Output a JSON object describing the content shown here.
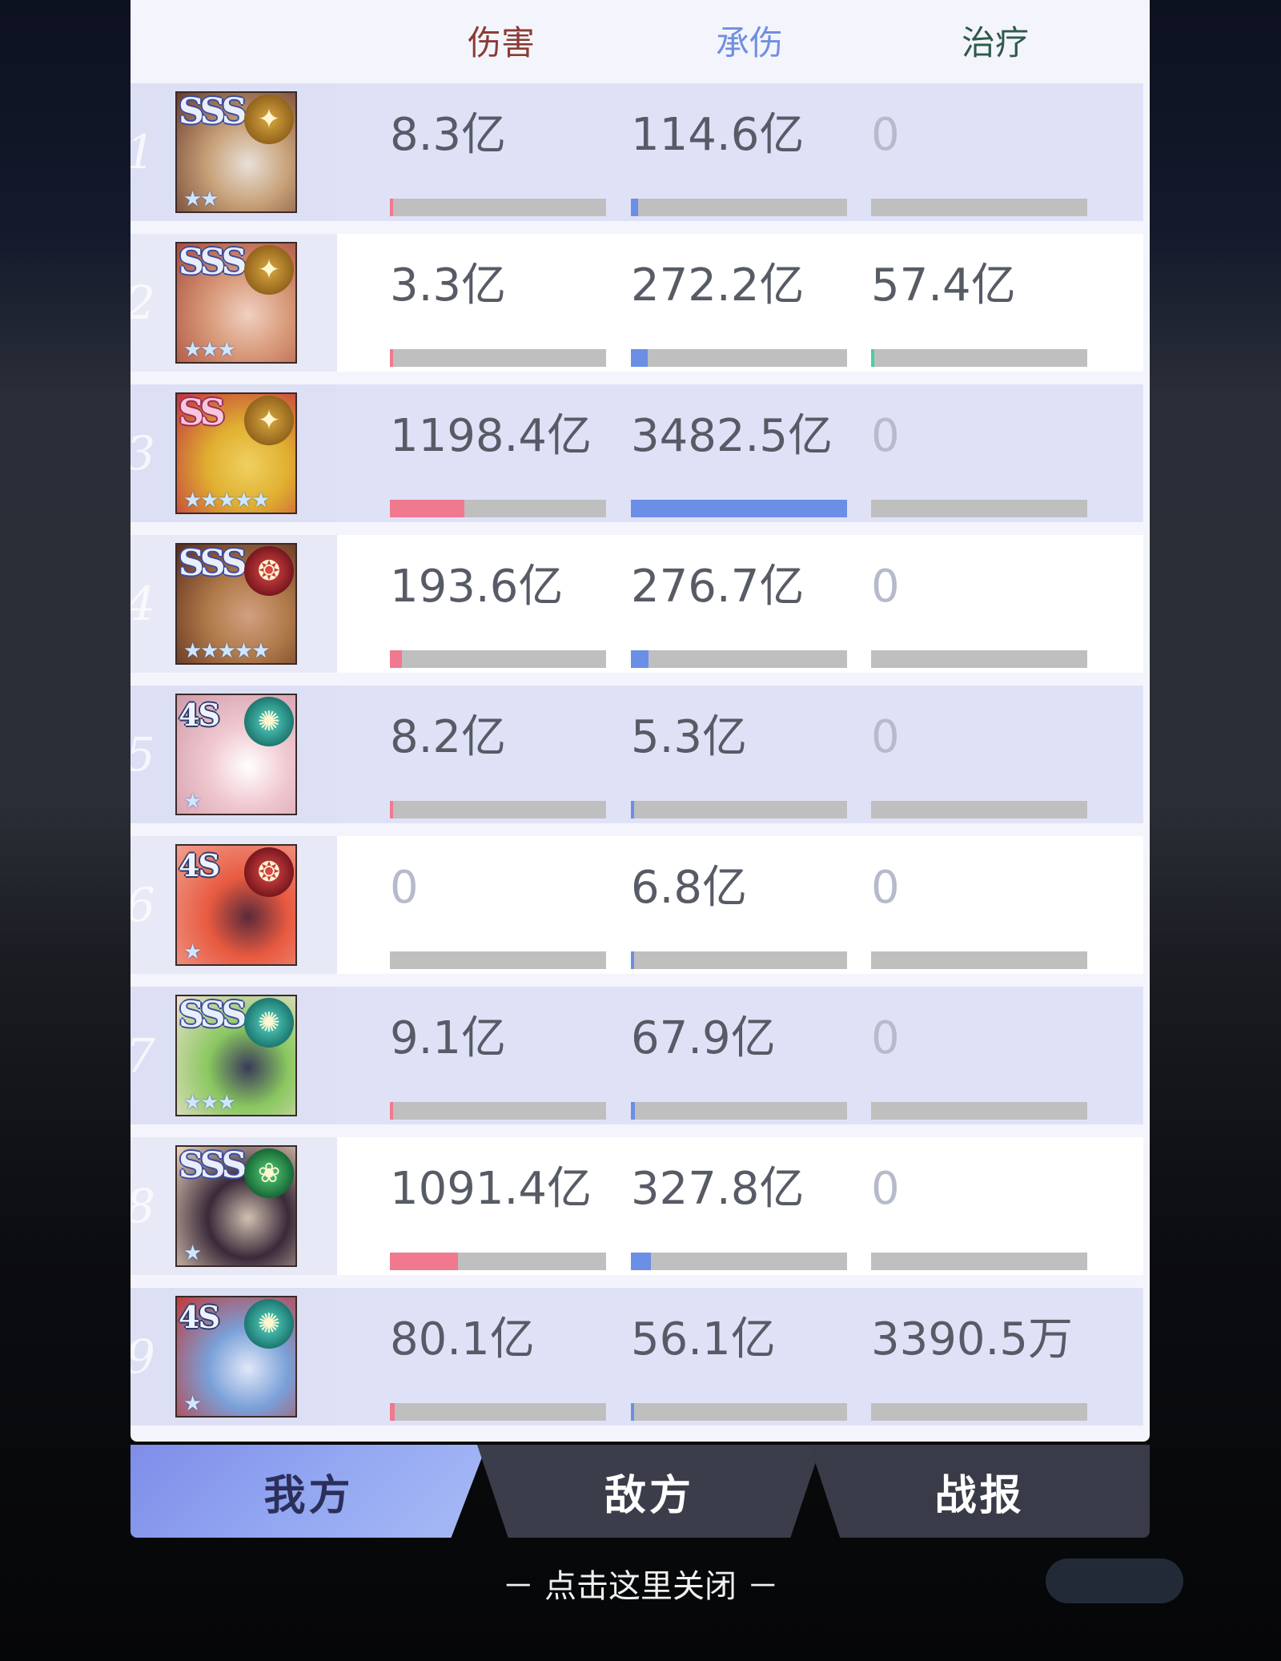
{
  "header": {
    "damage": "伤害",
    "taken": "承伤",
    "heal": "治疗",
    "damage_color": "#8a3b36",
    "taken_color": "#6f8fe0",
    "heal_color": "#2f5a4a"
  },
  "colors": {
    "damage_fill": "#f0798f",
    "taken_fill": "#6b8fe6",
    "heal_fill": "#45d0a8"
  },
  "rows": [
    {
      "index": "1",
      "rank": "SSS",
      "emblem": "gold",
      "stars": "★★",
      "damage": "8.3亿",
      "taken": "114.6亿",
      "heal": "0",
      "damage_pct": 0.009,
      "taken_pct": 0.033,
      "heal_pct": 0
    },
    {
      "index": "2",
      "rank": "SSS",
      "emblem": "gold",
      "stars": "★★★",
      "damage": "3.3亿",
      "taken": "272.2亿",
      "heal": "57.4亿",
      "damage_pct": 0.003,
      "taken_pct": 0.078,
      "heal_pct": 0.01
    },
    {
      "index": "3",
      "rank": "SS",
      "emblem": "gold",
      "stars": "★★★★★",
      "damage": "1198.4亿",
      "taken": "3482.5亿",
      "heal": "0",
      "damage_pct": 0.345,
      "taken_pct": 1.0,
      "heal_pct": 0
    },
    {
      "index": "4",
      "rank": "SSS",
      "emblem": "red",
      "stars": "★★★★★",
      "damage": "193.6亿",
      "taken": "276.7亿",
      "heal": "0",
      "damage_pct": 0.056,
      "taken_pct": 0.08,
      "heal_pct": 0
    },
    {
      "index": "5",
      "rank": "4S",
      "emblem": "teal",
      "stars": "★",
      "damage": "8.2亿",
      "taken": "5.3亿",
      "heal": "0",
      "damage_pct": 0.009,
      "taken_pct": 0.005,
      "heal_pct": 0
    },
    {
      "index": "6",
      "rank": "4S",
      "emblem": "red",
      "stars": "★",
      "damage": "0",
      "taken": "6.8亿",
      "heal": "0",
      "damage_pct": 0,
      "taken_pct": 0.005,
      "heal_pct": 0
    },
    {
      "index": "7",
      "rank": "SSS",
      "emblem": "teal",
      "stars": "★★★",
      "damage": "9.1亿",
      "taken": "67.9亿",
      "heal": "0",
      "damage_pct": 0.009,
      "taken_pct": 0.02,
      "heal_pct": 0
    },
    {
      "index": "8",
      "rank": "SSS",
      "emblem": "green",
      "stars": "★",
      "damage": "1091.4亿",
      "taken": "327.8亿",
      "heal": "0",
      "damage_pct": 0.314,
      "taken_pct": 0.094,
      "heal_pct": 0
    },
    {
      "index": "9",
      "rank": "4S",
      "emblem": "teal",
      "stars": "★",
      "damage": "80.1亿",
      "taken": "56.1亿",
      "heal": "3390.5万",
      "damage_pct": 0.023,
      "taken_pct": 0.016,
      "heal_pct": 0
    }
  ],
  "tabs": {
    "us": "我方",
    "enemy": "敌方",
    "report": "战报"
  },
  "close_hint": "－ 点击这里关闭 －"
}
